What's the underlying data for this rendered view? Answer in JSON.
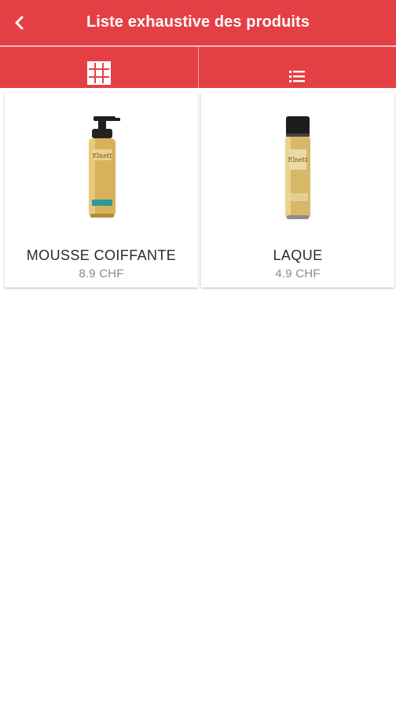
{
  "header": {
    "title": "Liste exhaustive des produits",
    "back_icon": "chevron-left-icon"
  },
  "view_toggle": {
    "grid_icon": "grid-view-icon",
    "list_icon": "list-view-icon",
    "active": "grid"
  },
  "products": [
    {
      "name": "MOUSSE COIFFANTE",
      "price": "8.9 CHF",
      "image": "mousse-bottle"
    },
    {
      "name": "LAQUE",
      "price": "4.9 CHF",
      "image": "hairspray-can"
    }
  ],
  "colors": {
    "brand": "#e53f46",
    "text": "#2a2a2a",
    "muted": "#8a8a8a"
  }
}
